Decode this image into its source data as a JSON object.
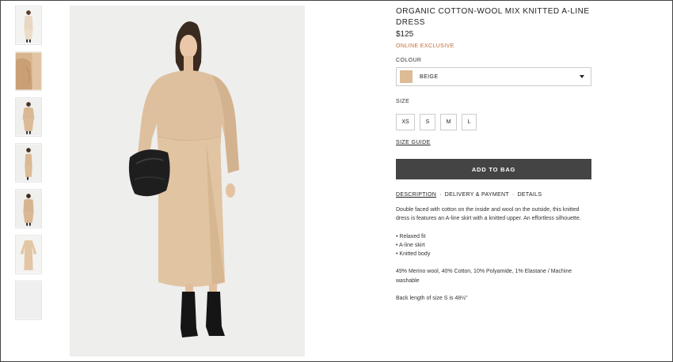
{
  "product": {
    "title": "ORGANIC COTTON-WOOL MIX KNITTED A-LINE DRESS",
    "price": "$125",
    "badge": "ONLINE EXCLUSIVE"
  },
  "colour": {
    "label": "COLOUR",
    "selected": "BEIGE",
    "swatch_color": "#dcbb95"
  },
  "size": {
    "label": "SIZE",
    "options": [
      "XS",
      "S",
      "M",
      "L"
    ],
    "guide": "SIZE GUIDE"
  },
  "add_to_bag": "ADD TO BAG",
  "tabs": {
    "description": "DESCRIPTION",
    "delivery": "DELIVERY & PAYMENT",
    "details": "DETAILS",
    "separator": "·"
  },
  "description": {
    "intro": "Double faced with cotton on the inside and wool on the outside, this knitted dress is features an A-line skirt with a knitted upper. An effortless silhouette.",
    "bullets": [
      "• Relaxed fit",
      "• A-line skirt",
      "• Knitted body"
    ],
    "composition": "49% Merino wool, 40% Cotton, 10% Polyamide, 1% Elastane / Machine washable",
    "length": "Back length of size S is 48½\""
  },
  "gallery": {
    "thumbnails": [
      "front-full",
      "detail-sleeve",
      "front-full-walk",
      "side-full",
      "back-full",
      "flat-lay",
      "blank"
    ]
  }
}
